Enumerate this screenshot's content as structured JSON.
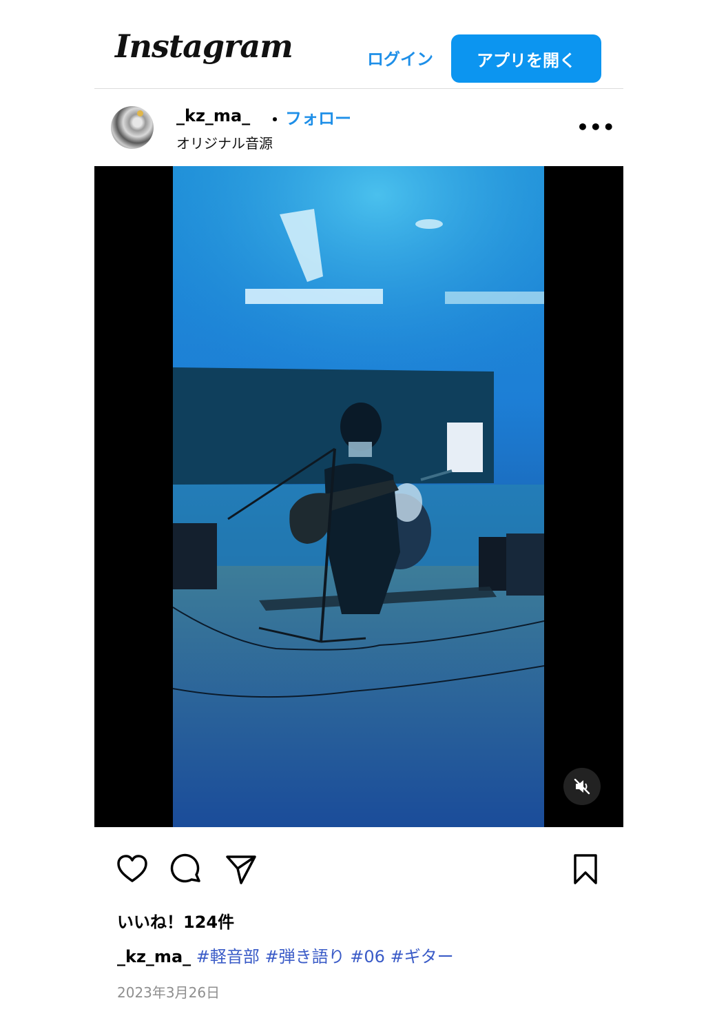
{
  "header": {
    "logo": "Instagram",
    "login_label": "ログイン",
    "open_app_label": "アプリを開く"
  },
  "post": {
    "username": "_kz_ma_",
    "separator": "・",
    "follow_label": "フォロー",
    "audio": "オリジナル音源",
    "more_label": "•••"
  },
  "likes": "いいね！124件",
  "caption": {
    "username": "_kz_ma_",
    "tags": [
      "#軽音部",
      "#弾き語り",
      "#06",
      "#ギター"
    ]
  },
  "date": "2023年3月26日",
  "icons": {
    "like": "heart-icon",
    "comment": "comment-icon",
    "share": "send-icon",
    "save": "bookmark-icon",
    "mute": "speaker-muted-icon"
  },
  "colors": {
    "accent": "#0c95f0",
    "link": "#1e8fe8",
    "hashtag": "#3a5bc7"
  }
}
